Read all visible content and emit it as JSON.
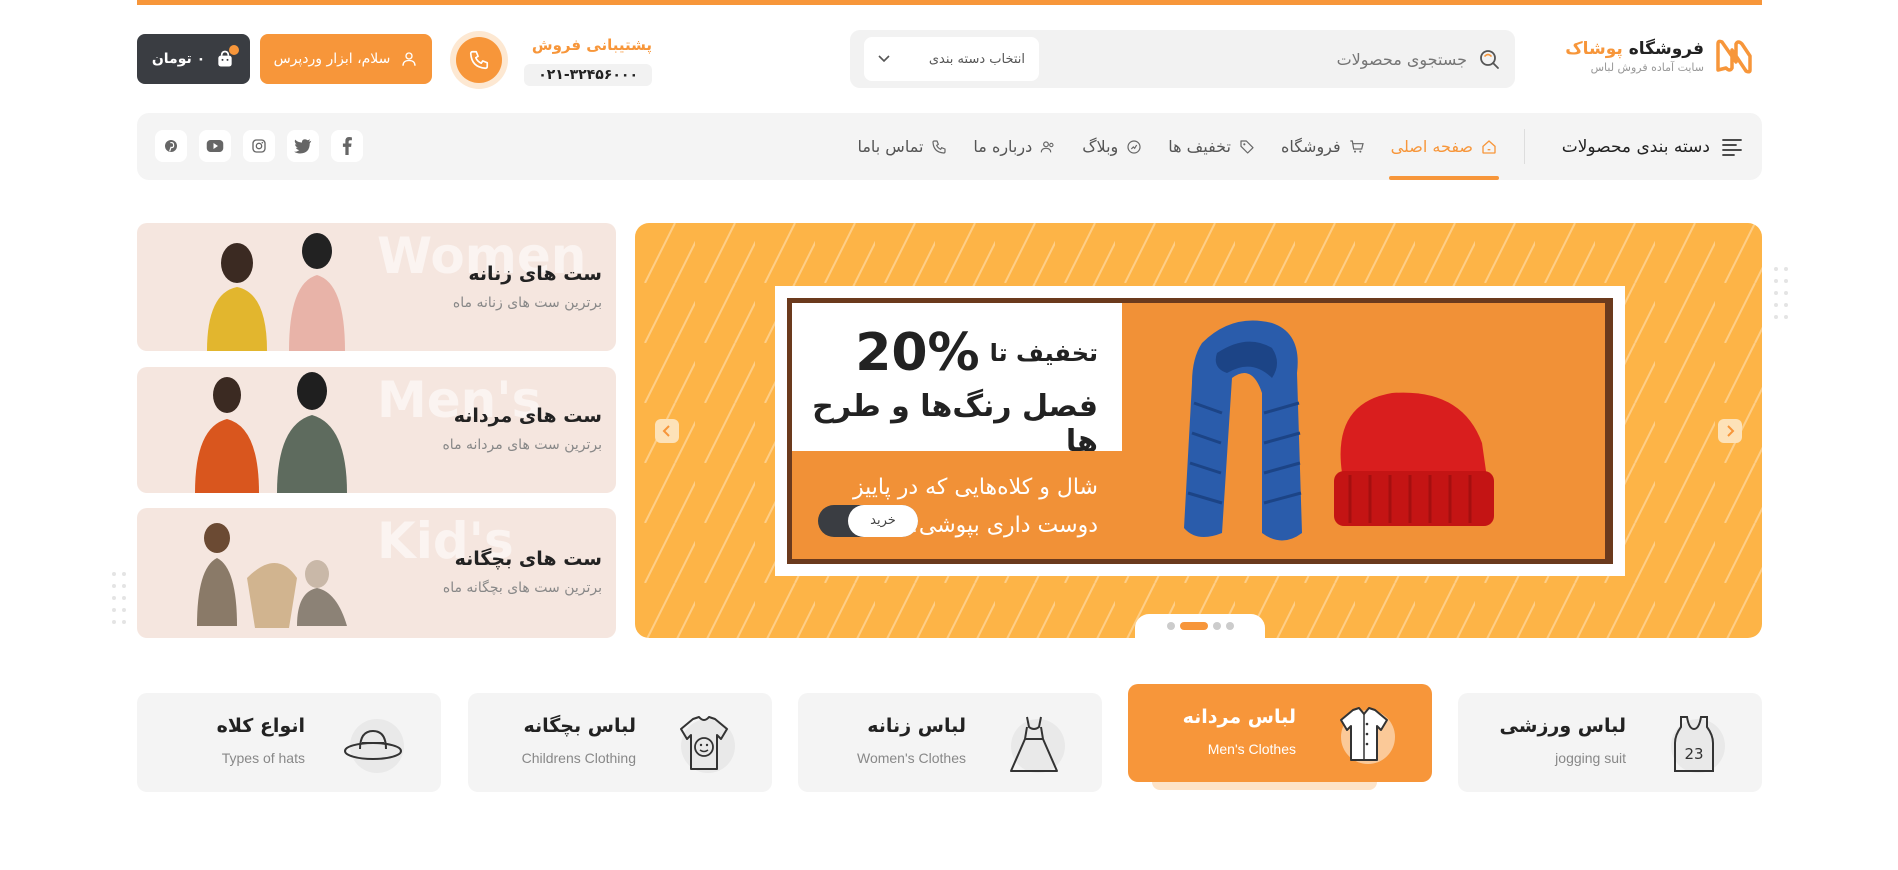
{
  "brand": {
    "title_main": "فروشگاه",
    "title_accent": "پوشاک",
    "subtitle": "سایت آماده فروش لباس",
    "accent_color": "#f7963a"
  },
  "search": {
    "placeholder": "جستجوی محصولات",
    "category_select": "انتخاب دسته بندی"
  },
  "support": {
    "title": "پشتیبانی فروش",
    "phone": "۰۲۱-۳۲۴۵۶۰۰۰"
  },
  "account": {
    "login_label": "سلام، ابزار وردپرس",
    "cart_label": "۰ تومان"
  },
  "nav": {
    "categories_label": "دسته بندی محصولات",
    "items": [
      {
        "label": "صفحه اصلی",
        "icon": "home-icon",
        "active": true
      },
      {
        "label": "فروشگاه",
        "icon": "cart-icon"
      },
      {
        "label": "تخفیف ها",
        "icon": "tag-icon"
      },
      {
        "label": "وبلاگ",
        "icon": "blog-icon"
      },
      {
        "label": "درباره ما",
        "icon": "users-icon"
      },
      {
        "label": "تماس باما",
        "icon": "phone-icon"
      }
    ],
    "socials": [
      "facebook-icon",
      "twitter-icon",
      "instagram-icon",
      "youtube-icon",
      "pinterest-icon"
    ]
  },
  "hero": {
    "discount_prefix": "تخفیف تا",
    "discount_value": "20%",
    "season_title": "فصل رنگ‌ها و طرح ها",
    "line1": "شال و کلاه‌هایی که در پاییز",
    "line2": "دوست داری بپوشی!",
    "buy_label": "خرید",
    "slides": 4,
    "active_slide": 2
  },
  "side_cards": [
    {
      "title": "ست های زنانه",
      "subtitle": "برترین ست های زنانه ماه",
      "ghost": "Women"
    },
    {
      "title": "ست های مردانه",
      "subtitle": "برترین ست های مردانه ماه",
      "ghost": "Men's"
    },
    {
      "title": "ست های بچگانه",
      "subtitle": "برترین ست های بچگانه ماه",
      "ghost": "Kid's"
    }
  ],
  "categories": [
    {
      "title": "لباس ورزشی",
      "subtitle": "jogging suit",
      "icon": "tank-top-icon"
    },
    {
      "title": "لباس مردانه",
      "subtitle": "Men's Clothes",
      "icon": "shirt-icon",
      "active": true
    },
    {
      "title": "لباس زنانه",
      "subtitle": "Women's Clothes",
      "icon": "dress-icon"
    },
    {
      "title": "لباس بچگانه",
      "subtitle": "Childrens Clothing",
      "icon": "kids-tshirt-icon"
    },
    {
      "title": "انواع کلاه",
      "subtitle": "Types of hats",
      "icon": "hat-icon"
    }
  ]
}
